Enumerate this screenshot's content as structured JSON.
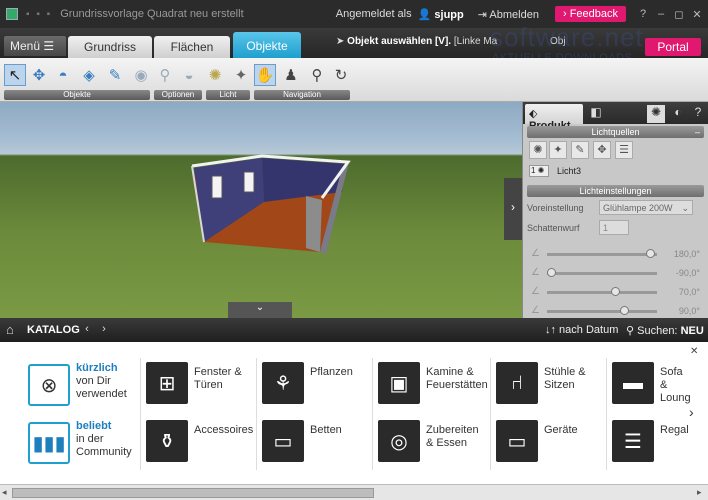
{
  "titlebar": {
    "window_title": "Grundrissvorlage Quadrat neu erstellt",
    "logged_in_label": "Angemeldet als",
    "user": "sjupp",
    "logout": "Abmelden",
    "feedback": "Feedback",
    "help": "?",
    "minimize": "–",
    "maximize": "◻",
    "close": "✕"
  },
  "tabbar": {
    "menu": "Menü ☰",
    "tabs": [
      "Grundriss",
      "Flächen",
      "Objekte"
    ],
    "active_tab": "Objekte",
    "status_bold": "Objekt auswählen [V].",
    "status_rest": " [Linke Ma",
    "status_tail": "Obj",
    "portal": "Portal",
    "watermark": "software.net",
    "watermark_sub": "AKTUELLE DOWNLOADS"
  },
  "toolbar": {
    "groups": [
      "Objekte",
      "Optionen",
      "Licht",
      "Navigation"
    ]
  },
  "view3d": {
    "expand_right": "›",
    "expand_down": "⌄"
  },
  "panel": {
    "tab_product": "Produkt",
    "tab_help": "?",
    "section_lights": "Lichtquellen",
    "section_min": "–",
    "light_number": "1",
    "light_name": "Licht3",
    "section_settings": "Lichteinstellungen",
    "preset_label": "Voreinstellung",
    "preset_value": "Glühlampe 200W",
    "shadow_label": "Schattenwurf",
    "shadow_value": "1",
    "sliders": [
      {
        "value": "180,0°",
        "level": 0.95
      },
      {
        "value": "-90,0°",
        "level": 0.0
      },
      {
        "value": "70,0°",
        "level": 0.62
      },
      {
        "value": "90,0°",
        "level": 0.7
      }
    ]
  },
  "catalog": {
    "title": "KATALOG",
    "prev": "‹",
    "next": "›",
    "sort": "↓↑ nach Datum",
    "search_label": "Suchen:",
    "search_value": "NEU",
    "close": "✕",
    "quick": [
      {
        "bold": "kürzlich",
        "rest1": "von Dir",
        "rest2": "verwendet"
      },
      {
        "bold": "beliebt",
        "rest1": "in der",
        "rest2": "Community"
      }
    ],
    "items": [
      {
        "line1": "Fenster &",
        "line2": "Türen"
      },
      {
        "line1": "Pflanzen",
        "line2": ""
      },
      {
        "line1": "Kamine &",
        "line2": "Feuerstätten"
      },
      {
        "line1": "Stühle &",
        "line2": "Sitzen"
      },
      {
        "line1": "Sofa &",
        "line2": "Loung"
      },
      {
        "line1": "Accessoires",
        "line2": ""
      },
      {
        "line1": "Betten",
        "line2": ""
      },
      {
        "line1": "Zubereiten",
        "line2": "& Essen"
      },
      {
        "line1": "Geräte",
        "line2": ""
      },
      {
        "line1": "Regal",
        "line2": ""
      }
    ],
    "more": "›"
  },
  "scrollbar": {
    "left": "◂",
    "right": "▸"
  }
}
